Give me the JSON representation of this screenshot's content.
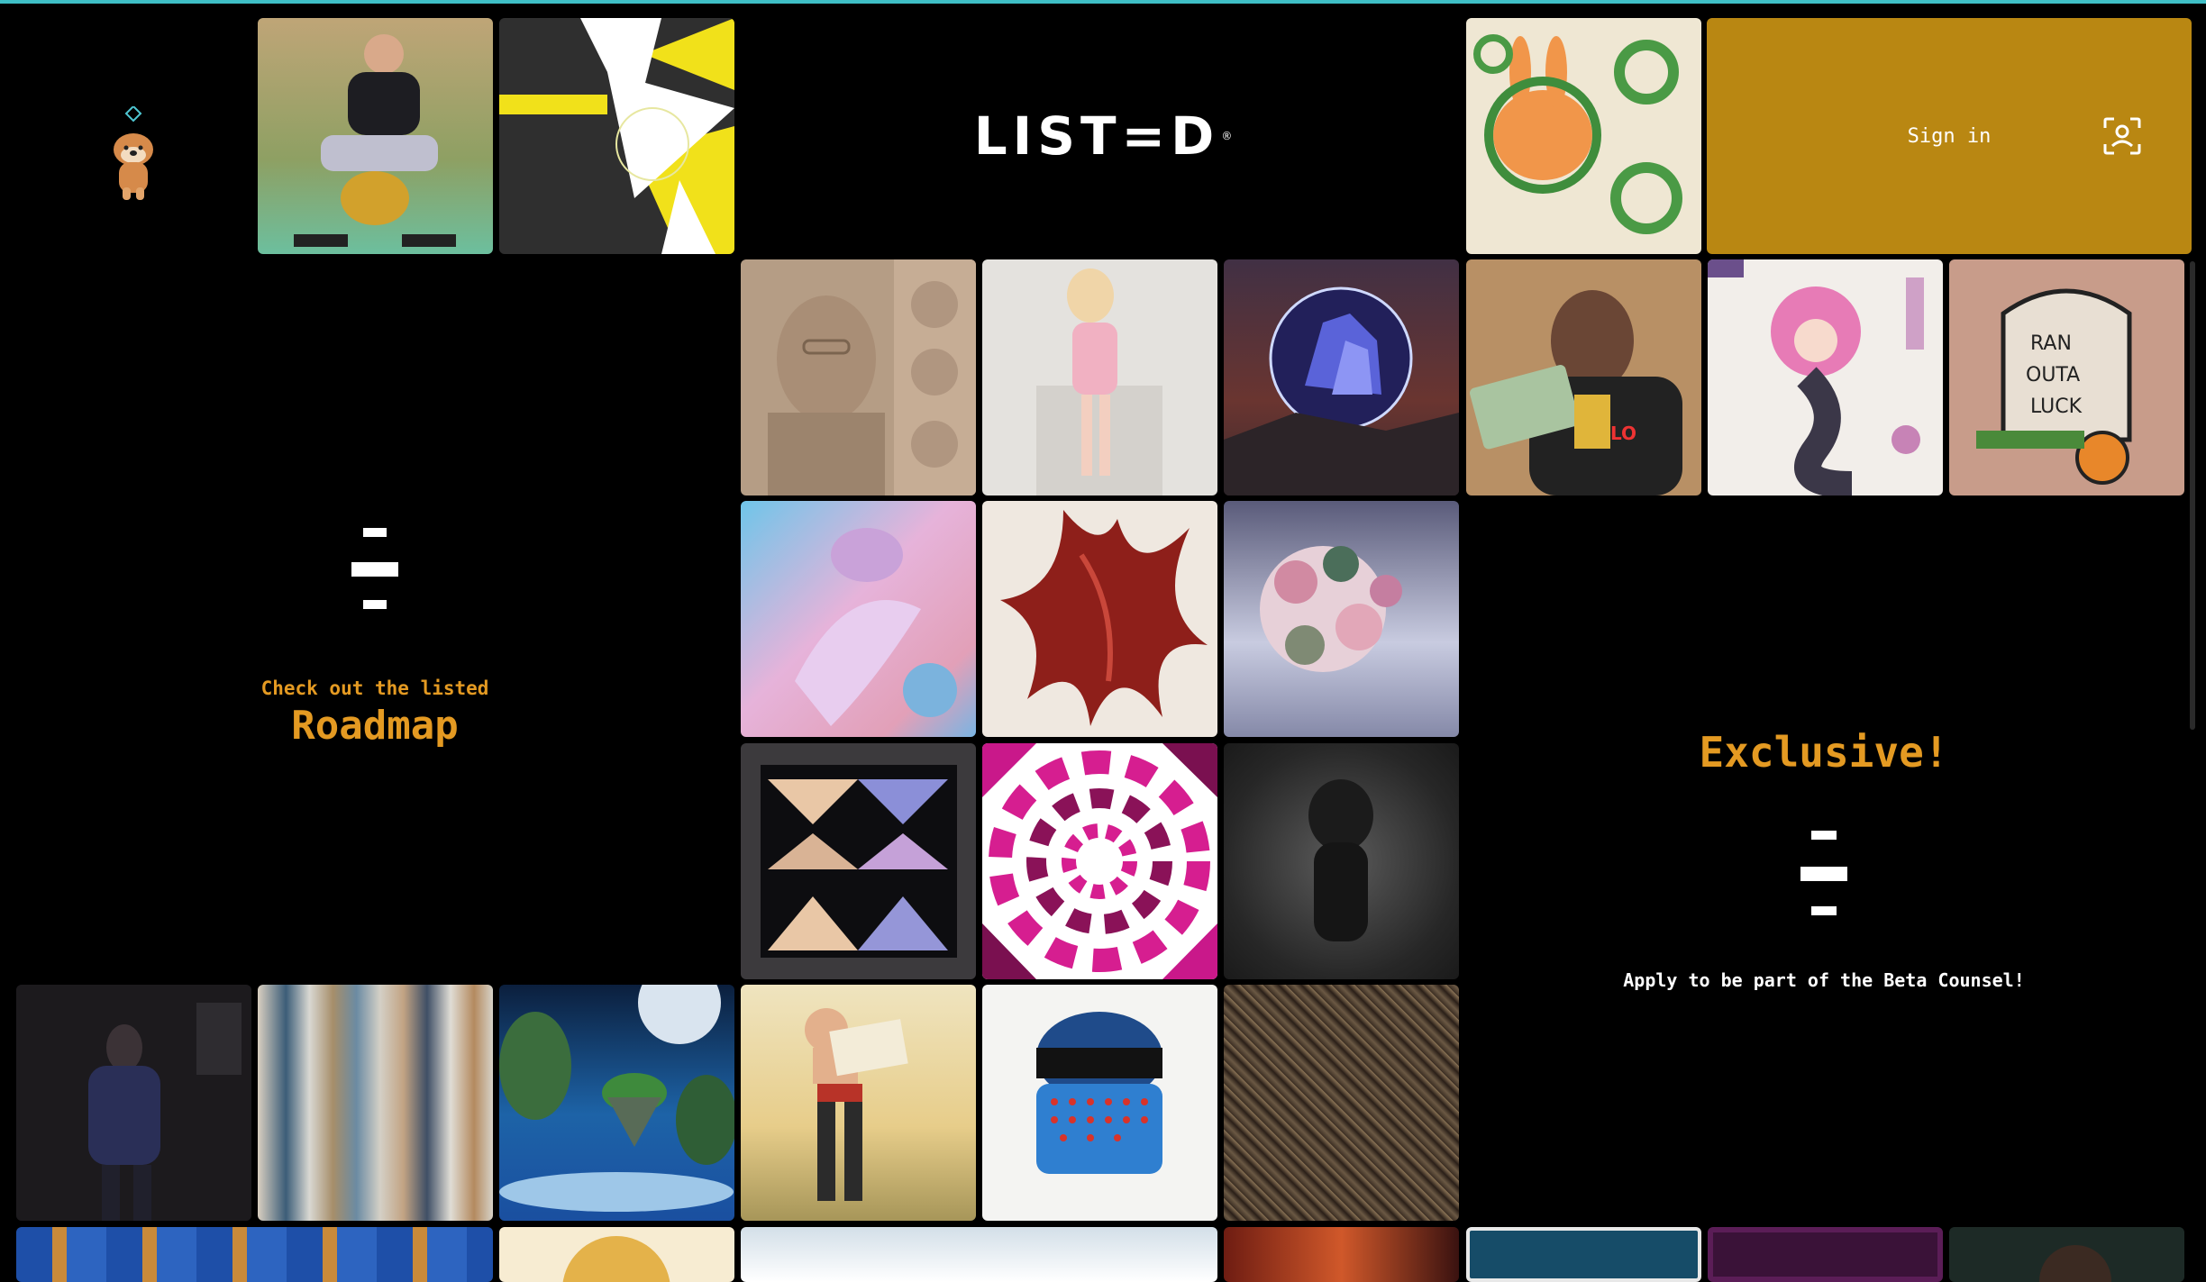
{
  "brand": {
    "logo_text": "LIST=D",
    "registered": "®"
  },
  "header": {
    "sign_in_label": "Sign in",
    "sign_in_icon": "face-id-icon"
  },
  "roadmap": {
    "intro": "Check out the listed",
    "title": "Roadmap"
  },
  "exclusive": {
    "title": "Exclusive!",
    "subtitle": "Apply to be part of the Beta Counsel!"
  },
  "colors": {
    "accent": "#e49a22",
    "signin_bg": "#b98712",
    "top_bar": "#3fbfc6",
    "background": "#000000"
  },
  "gallery": {
    "tiles": [
      {
        "name": "man-gold-toilet-artwork"
      },
      {
        "name": "abstract-yellow-burst-artwork"
      },
      {
        "name": "rabbit-wreath-artwork"
      },
      {
        "name": "sketch-portrait-artwork"
      },
      {
        "name": "doll-pink-dress-artwork"
      },
      {
        "name": "crystal-sphere-artwork"
      },
      {
        "name": "money-portrait-artwork"
      },
      {
        "name": "mermaid-illustration-artwork"
      },
      {
        "name": "tattoo-ran-outta-luck-artwork"
      },
      {
        "name": "pastel-figure-artwork"
      },
      {
        "name": "red-splash-artwork"
      },
      {
        "name": "flower-head-artwork"
      },
      {
        "name": "geometric-pattern-artwork"
      },
      {
        "name": "pink-spiral-artwork"
      },
      {
        "name": "dark-figure-artwork"
      },
      {
        "name": "dark-room-figure-artwork"
      },
      {
        "name": "vertical-stripes-artwork"
      },
      {
        "name": "floating-islands-artwork"
      },
      {
        "name": "pinup-woman-artwork"
      },
      {
        "name": "blue-paint-artwork"
      },
      {
        "name": "texture-pattern-artwork"
      },
      {
        "name": "pixel-map-artwork"
      },
      {
        "name": "coin-artwork"
      },
      {
        "name": "clouds-artwork"
      },
      {
        "name": "fire-portrait-artwork"
      },
      {
        "name": "teal-frame-artwork"
      },
      {
        "name": "purple-frame-artwork"
      },
      {
        "name": "dark-portrait-artwork"
      }
    ]
  }
}
